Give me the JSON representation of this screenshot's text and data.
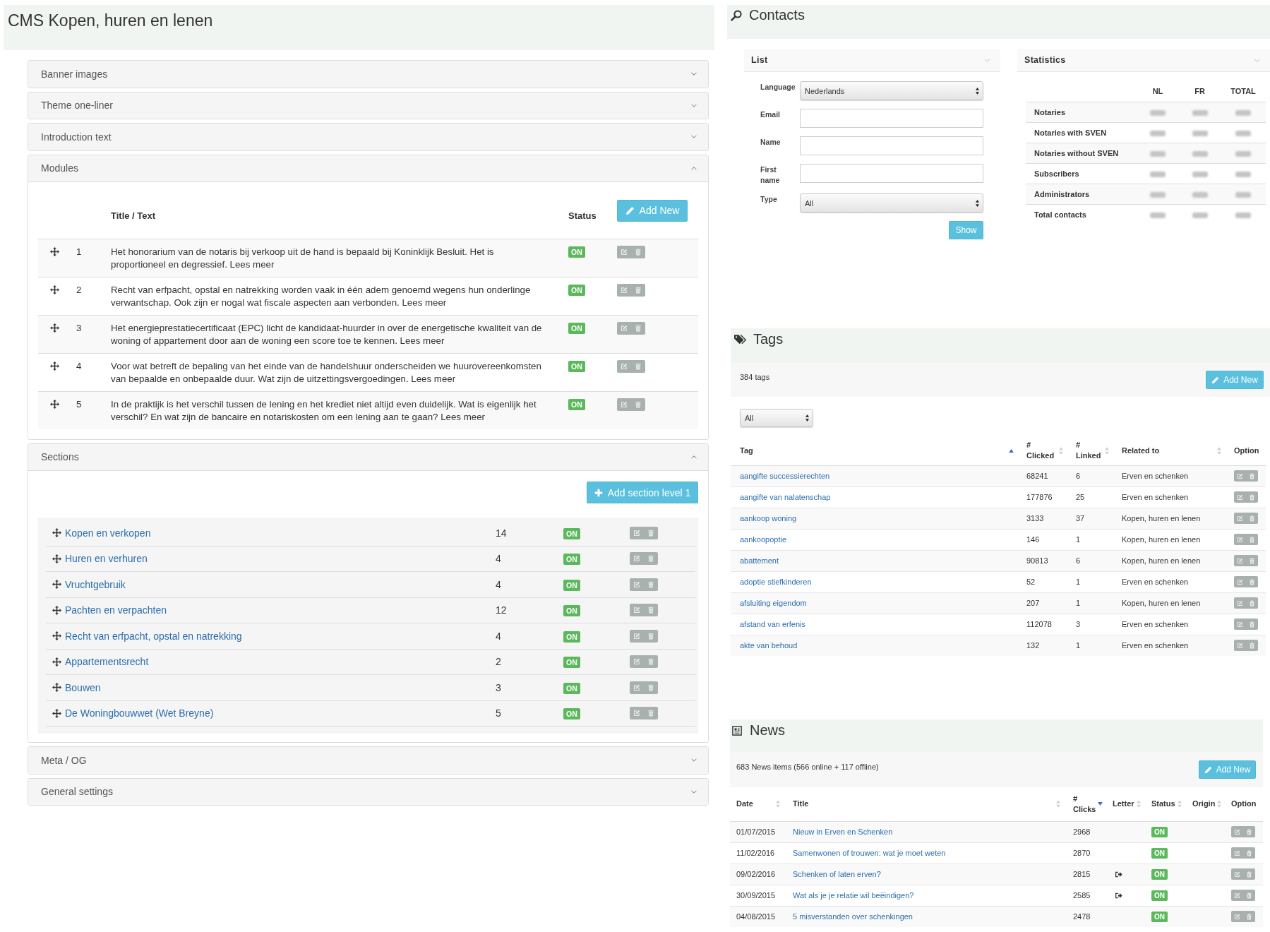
{
  "cms": {
    "title": "CMS Kopen, huren en lenen",
    "panels": [
      {
        "title": "Banner images",
        "expanded": false
      },
      {
        "title": "Theme one-liner",
        "expanded": false
      },
      {
        "title": "Introduction text",
        "expanded": false
      },
      {
        "title": "Modules",
        "expanded": true,
        "modules": {
          "columns": [
            "Title / Text",
            "Status"
          ],
          "add_button": "Add New",
          "rows": [
            {
              "number": "1",
              "text": "Het honorarium van de notaris bij verkoop uit de hand is bepaald bij Koninklijk Besluit. Het is proportioneel en degressief. Lees meer",
              "status": "ON"
            },
            {
              "number": "2",
              "text": "Recht van erfpacht, opstal en natrekking worden vaak in één adem genoemd wegens hun onderlinge verwantschap. Ook zijn er nogal wat fiscale aspecten aan verbonden. Lees meer",
              "status": "ON"
            },
            {
              "number": "3",
              "text": "Het energieprestatiecertificaat (EPC) licht de kandidaat-huurder in over de energetische kwaliteit van de woning of appartement door aan de woning een score toe te kennen. Lees meer",
              "status": "ON"
            },
            {
              "number": "4",
              "text": "Voor wat betreft de bepaling van het einde van de handelshuur onderscheiden we huurovereenkomsten van bepaalde en onbepaalde duur. Wat zijn de uitzettingsvergoedingen. Lees meer",
              "status": "ON"
            },
            {
              "number": "5",
              "text": "In de praktijk is het verschil tussen de lening en het krediet niet altijd even duidelijk. Wat is eigenlijk het verschil? En wat zijn de bancaire en notariskosten om een lening aan te gaan? Lees meer",
              "status": "ON"
            }
          ]
        }
      },
      {
        "title": "Sections",
        "expanded": true,
        "sections": {
          "add_button": "Add section level 1",
          "rows": [
            {
              "title": "Kopen en verkopen",
              "count": "14",
              "status": "ON"
            },
            {
              "title": "Huren en verhuren",
              "count": "4",
              "status": "ON"
            },
            {
              "title": "Vruchtgebruik",
              "count": "4",
              "status": "ON"
            },
            {
              "title": "Pachten en verpachten",
              "count": "12",
              "status": "ON"
            },
            {
              "title": "Recht van erfpacht, opstal en natrekking",
              "count": "4",
              "status": "ON"
            },
            {
              "title": "Appartementsrecht",
              "count": "2",
              "status": "ON"
            },
            {
              "title": "Bouwen",
              "count": "3",
              "status": "ON"
            },
            {
              "title": "De Woningbouwwet (Wet Breyne)",
              "count": "5",
              "status": "ON"
            }
          ]
        }
      },
      {
        "title": "Meta / OG",
        "expanded": false
      },
      {
        "title": "General settings",
        "expanded": false
      }
    ]
  },
  "contacts": {
    "title": "Contacts",
    "list": {
      "title": "List",
      "fields": [
        {
          "label": "Language",
          "kind": "select",
          "value": "Nederlands"
        },
        {
          "label": "Email",
          "kind": "text"
        },
        {
          "label": "Name",
          "kind": "text"
        },
        {
          "label": "First name",
          "kind": "text"
        },
        {
          "label": "Type",
          "kind": "select",
          "value": "All"
        }
      ],
      "submit": "Show"
    },
    "statistics": {
      "title": "Statistics",
      "columns": [
        "NL",
        "FR",
        "TOTAL"
      ],
      "rows": [
        "Notaries",
        "Notaries with SVEN",
        "Notaries without SVEN",
        "Subscribers",
        "Administrators",
        "Total contacts"
      ],
      "values_blurred": true
    }
  },
  "tags": {
    "title": "Tags",
    "count": "384 tags",
    "add_button": "Add New",
    "filter": {
      "value": "All"
    },
    "columns": [
      {
        "label": "Tag",
        "sortable": true,
        "sorted_ascending": true,
        "sorted_descending": false
      },
      {
        "label": "# Clicked",
        "sortable": true,
        "sorted_ascending": false,
        "sorted_descending": false
      },
      {
        "label": "# Linked",
        "sortable": true,
        "sorted_ascending": false,
        "sorted_descending": false
      },
      {
        "label": "Related to",
        "sortable": true,
        "sorted_ascending": false,
        "sorted_descending": false
      },
      {
        "label": "Option",
        "sortable": false
      }
    ],
    "rows": [
      {
        "tag": "aangifte successierechten",
        "clicked": "68241",
        "linked": "6",
        "related_to": "Erven en schenken"
      },
      {
        "tag": "aangifte van nalatenschap",
        "clicked": "177876",
        "linked": "25",
        "related_to": "Erven en schenken"
      },
      {
        "tag": "aankoop woning",
        "clicked": "3133",
        "linked": "37",
        "related_to": "Kopen, huren en lenen"
      },
      {
        "tag": "aankoopoptie",
        "clicked": "146",
        "linked": "1",
        "related_to": "Kopen, huren en lenen"
      },
      {
        "tag": "abattement",
        "clicked": "90813",
        "linked": "6",
        "related_to": "Kopen, huren en lenen"
      },
      {
        "tag": "adoptie stiefkinderen",
        "clicked": "52",
        "linked": "1",
        "related_to": "Erven en schenken"
      },
      {
        "tag": "afsluiting eigendom",
        "clicked": "207",
        "linked": "1",
        "related_to": "Kopen, huren en lenen"
      },
      {
        "tag": "afstand van erfenis",
        "clicked": "112078",
        "linked": "3",
        "related_to": "Erven en schenken"
      },
      {
        "tag": "akte van behoud",
        "clicked": "132",
        "linked": "1",
        "related_to": "Erven en schenken"
      }
    ]
  },
  "news": {
    "title": "News",
    "summary": "683 News items (566 online + 117 offline)",
    "add_button": "Add New",
    "columns": [
      {
        "label": "Date",
        "sortable": true,
        "sorted_ascending": false,
        "sorted_descending": false
      },
      {
        "label": "Title",
        "sortable": true,
        "sorted_ascending": false,
        "sorted_descending": false
      },
      {
        "label": "# Clicks",
        "sortable": true,
        "sorted_ascending": false,
        "sorted_descending": true
      },
      {
        "label": "Letter",
        "sortable": true,
        "sorted_ascending": false,
        "sorted_descending": false
      },
      {
        "label": "Status",
        "sortable": true,
        "sorted_ascending": false,
        "sorted_descending": false
      },
      {
        "label": "Origin",
        "sortable": true,
        "sorted_ascending": false,
        "sorted_descending": false
      },
      {
        "label": "Option",
        "sortable": false
      }
    ],
    "rows": [
      {
        "date": "01/07/2015",
        "title": "Nieuw in Erven en Schenken",
        "clicks": "2968",
        "letter": false,
        "status": "ON"
      },
      {
        "date": "11/02/2016",
        "title": "Samenwonen of trouwen: wat je moet weten",
        "clicks": "2870",
        "letter": false,
        "status": "ON"
      },
      {
        "date": "09/02/2016",
        "title": "Schenken of laten erven?",
        "clicks": "2815",
        "letter": true,
        "status": "ON"
      },
      {
        "date": "30/09/2015",
        "title": "Wat als je je relatie wil beëindigen?",
        "clicks": "2585",
        "letter": true,
        "status": "ON"
      },
      {
        "date": "04/08/2015",
        "title": "5 misverstanden over schenkingen",
        "clicks": "2478",
        "letter": false,
        "status": "ON"
      }
    ]
  }
}
